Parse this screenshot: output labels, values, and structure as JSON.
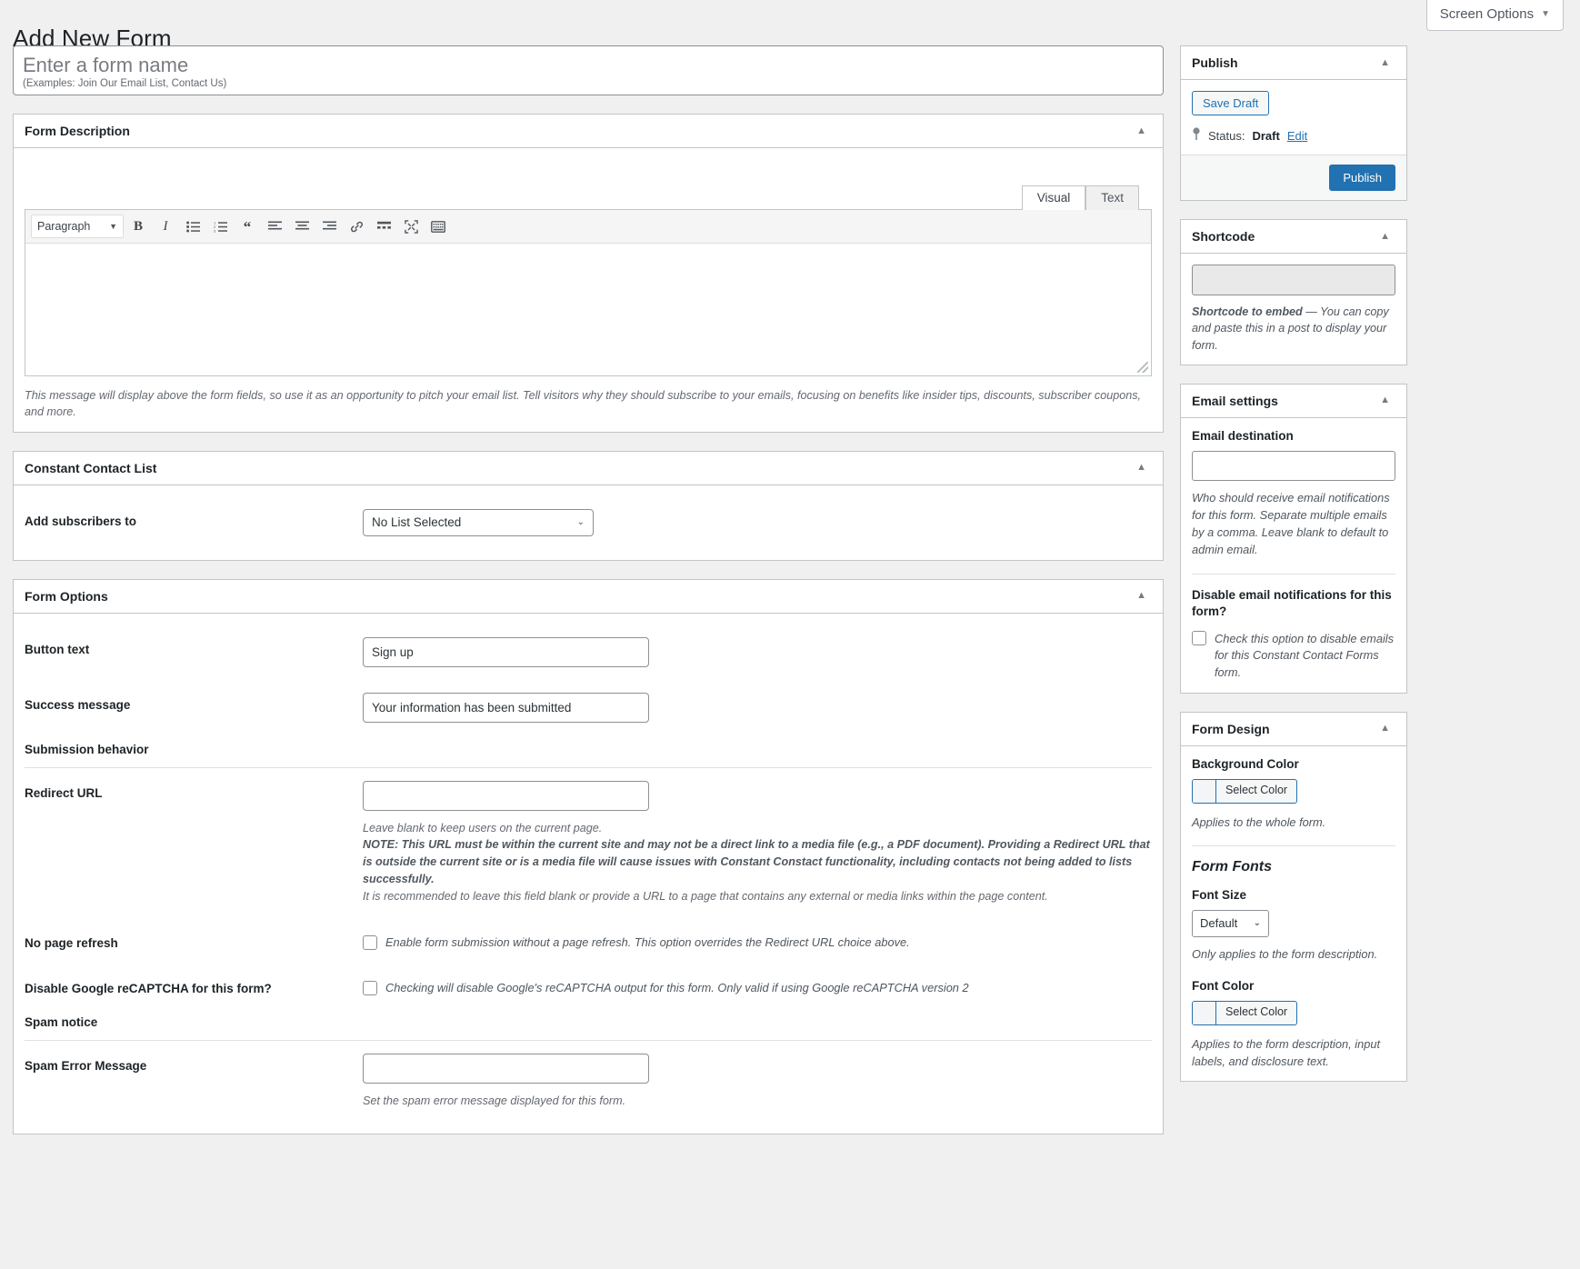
{
  "page": {
    "title": "Add New Form",
    "screen_options_label": "Screen Options",
    "caret_down": "▼",
    "caret_up": "▲",
    "caret_small_down": "⌄"
  },
  "title_field": {
    "placeholder": "Enter a form name",
    "value": "",
    "hint": "(Examples: Join Our Email List, Contact Us)"
  },
  "form_description": {
    "heading": "Form Description",
    "tabs": {
      "visual": "Visual",
      "text": "Text"
    },
    "format_select": "Paragraph",
    "content": "",
    "help": "This message will display above the form fields, so use it as an opportunity to pitch your email list. Tell visitors why they should subscribe to your emails, focusing on benefits like insider tips, discounts, subscriber coupons, and more.",
    "toolbar": [
      "bold-icon",
      "italic-icon",
      "bulleted-list-icon",
      "numbered-list-icon",
      "blockquote-icon",
      "align-left-icon",
      "align-center-icon",
      "align-right-icon",
      "link-icon",
      "read-more-icon",
      "fullscreen-icon",
      "toolbar-toggle-icon"
    ]
  },
  "constant_contact_list": {
    "heading": "Constant Contact List",
    "label": "Add subscribers to",
    "selected": "No List Selected"
  },
  "form_options": {
    "heading": "Form Options",
    "button_text": {
      "label": "Button text",
      "value": "Sign up"
    },
    "success_message": {
      "label": "Success message",
      "value": "Your information has been submitted"
    },
    "submission_behavior_heading": "Submission behavior",
    "redirect_url": {
      "label": "Redirect URL",
      "value": "",
      "help": "Leave blank to keep users on the current page.",
      "note": "NOTE: This URL must be within the current site and may not be a direct link to a media file (e.g., a PDF document). Providing a Redirect URL that is outside the current site or is a media file will cause issues with Constant Constact functionality, including contacts not being added to lists successfully.",
      "recommendation": "It is recommended to leave this field blank or provide a URL to a page that contains any external or media links within the page content."
    },
    "no_page_refresh": {
      "label": "No page refresh",
      "checked": false,
      "description": "Enable form submission without a page refresh. This option overrides the Redirect URL choice above."
    },
    "disable_recaptcha": {
      "label": "Disable Google reCAPTCHA for this form?",
      "checked": false,
      "description": "Checking will disable Google's reCAPTCHA output for this form. Only valid if using Google reCAPTCHA version 2"
    },
    "spam_notice_heading": "Spam notice",
    "spam_error_message": {
      "label": "Spam Error Message",
      "value": "",
      "help": "Set the spam error message displayed for this form."
    }
  },
  "publish_box": {
    "heading": "Publish",
    "save_draft": "Save Draft",
    "status_label": "Status:",
    "status_value": "Draft",
    "edit_link": "Edit",
    "publish_button": "Publish"
  },
  "shortcode_box": {
    "heading": "Shortcode",
    "value": "",
    "note_strong": "Shortcode to embed",
    "note_rest": " — You can copy and paste this in a post to display your form."
  },
  "email_settings": {
    "heading": "Email settings",
    "destination_label": "Email destination",
    "destination_value": "",
    "destination_desc": "Who should receive email notifications for this form. Separate multiple emails by a comma. Leave blank to default to admin email.",
    "disable_label": "Disable email notifications for this form?",
    "disable_checked": false,
    "disable_desc": "Check this option to disable emails for this Constant Contact Forms form."
  },
  "form_design": {
    "heading": "Form Design",
    "background_color_label": "Background Color",
    "background_color_button": "Select Color",
    "background_color_desc": "Applies to the whole form.",
    "fonts_heading": "Form Fonts",
    "font_size_label": "Font Size",
    "font_size_value": "Default",
    "font_size_desc": "Only applies to the form description.",
    "font_color_label": "Font Color",
    "font_color_button": "Select Color",
    "font_color_desc": "Applies to the form description, input labels, and disclosure text."
  },
  "colors": {
    "accent": "#2271b1",
    "border": "#c3c4c7",
    "page_bg": "#f0f0f1",
    "text": "#3c434a"
  }
}
